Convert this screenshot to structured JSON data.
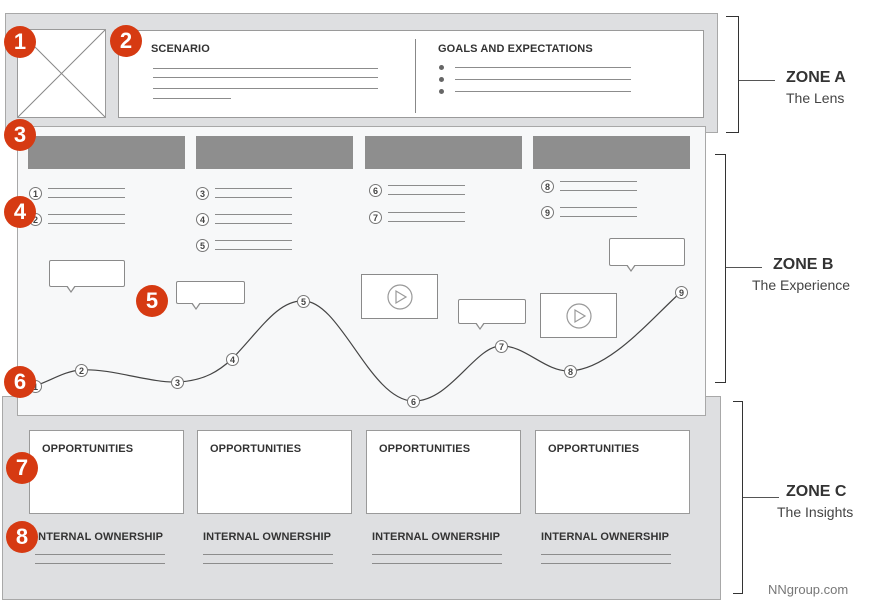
{
  "zone_a": {
    "title": "ZONE A",
    "subtitle": "The Lens",
    "scenario_heading": "SCENARIO",
    "goals_heading": "GOALS AND EXPECTATIONS",
    "goal_bullet_count": 3
  },
  "zone_b": {
    "title": "ZONE B",
    "subtitle": "The Experience",
    "stages": [
      {
        "steps": [
          "1",
          "2"
        ]
      },
      {
        "steps": [
          "3",
          "4",
          "5"
        ]
      },
      {
        "steps": [
          "6",
          "7"
        ]
      },
      {
        "steps": [
          "8",
          "9"
        ]
      }
    ],
    "curve_points": [
      "1",
      "2",
      "3",
      "4",
      "5",
      "6",
      "7",
      "8",
      "9"
    ]
  },
  "zone_c": {
    "title": "ZONE C",
    "subtitle": "The Insights",
    "columns": [
      {
        "opportunities": "OPPORTUNITIES",
        "ownership": "INTERNAL OWNERSHIP"
      },
      {
        "opportunities": "OPPORTUNITIES",
        "ownership": "INTERNAL OWNERSHIP"
      },
      {
        "opportunities": "OPPORTUNITIES",
        "ownership": "INTERNAL OWNERSHIP"
      },
      {
        "opportunities": "OPPORTUNITIES",
        "ownership": "INTERNAL OWNERSHIP"
      }
    ]
  },
  "markers": [
    "1",
    "2",
    "3",
    "4",
    "5",
    "6",
    "7",
    "8"
  ],
  "colors": {
    "marker": "#d63a12",
    "panel": "#dedfe1",
    "stage_bar": "#8e8e8e"
  },
  "footer": "NNgroup.com"
}
